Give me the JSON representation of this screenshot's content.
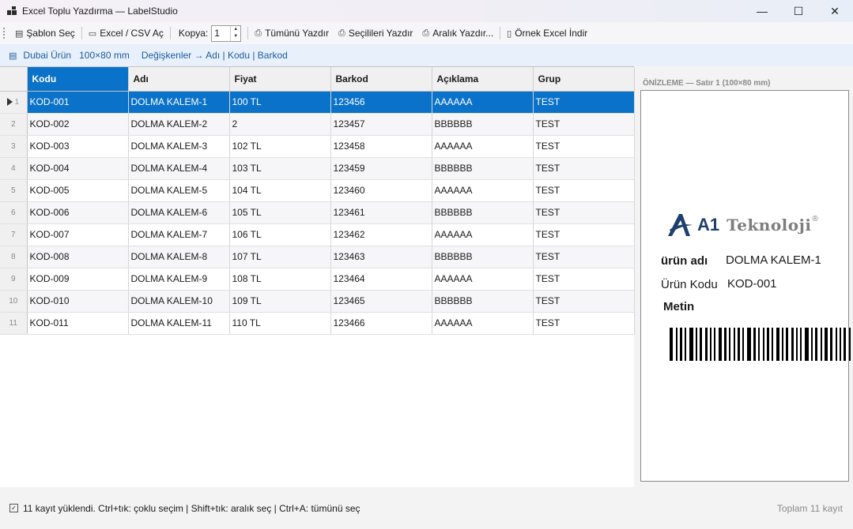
{
  "window": {
    "title": "Excel Toplu Yazdırma — LabelStudio",
    "minimize_icon": "—",
    "maximize_icon": "☐",
    "close_icon": "✕"
  },
  "toolbar": {
    "template_select": "Şablon Seç",
    "open_excel": "Excel / CSV Aç",
    "copies_label": "Kopya:",
    "copies_value": "1",
    "print_all": "Tümünü Yazdır",
    "print_selected": "Seçilileri Yazdır",
    "print_range": "Aralık Yazdır...",
    "download_sample": "Örnek Excel İndir"
  },
  "infobar": {
    "template_name": "Dubai Ürün",
    "template_size": "100×80 mm",
    "variables": "Değişkenler → Adı  |  Kodu  |  Barkod"
  },
  "grid": {
    "columns": [
      "Kodu",
      "Adı",
      "Fiyat",
      "Barkod",
      "Açıklama",
      "Grup"
    ],
    "selected_column": 0,
    "selected_row": 0,
    "rows": [
      {
        "n": "1",
        "cells": [
          "KOD-001",
          "DOLMA KALEM-1",
          "100 TL",
          "123456",
          "AAAAAA",
          "TEST"
        ]
      },
      {
        "n": "2",
        "cells": [
          "KOD-002",
          "DOLMA KALEM-2",
          "2",
          "123457",
          "BBBBBB",
          "TEST"
        ]
      },
      {
        "n": "3",
        "cells": [
          "KOD-003",
          "DOLMA KALEM-3",
          "102 TL",
          "123458",
          "AAAAAA",
          "TEST"
        ]
      },
      {
        "n": "4",
        "cells": [
          "KOD-004",
          "DOLMA KALEM-4",
          "103 TL",
          "123459",
          "BBBBBB",
          "TEST"
        ]
      },
      {
        "n": "5",
        "cells": [
          "KOD-005",
          "DOLMA KALEM-5",
          "104 TL",
          "123460",
          "AAAAAA",
          "TEST"
        ]
      },
      {
        "n": "6",
        "cells": [
          "KOD-006",
          "DOLMA KALEM-6",
          "105 TL",
          "123461",
          "BBBBBB",
          "TEST"
        ]
      },
      {
        "n": "7",
        "cells": [
          "KOD-007",
          "DOLMA KALEM-7",
          "106 TL",
          "123462",
          "AAAAAA",
          "TEST"
        ]
      },
      {
        "n": "8",
        "cells": [
          "KOD-008",
          "DOLMA KALEM-8",
          "107 TL",
          "123463",
          "BBBBBB",
          "TEST"
        ]
      },
      {
        "n": "9",
        "cells": [
          "KOD-009",
          "DOLMA KALEM-9",
          "108 TL",
          "123464",
          "AAAAAA",
          "TEST"
        ]
      },
      {
        "n": "10",
        "cells": [
          "KOD-010",
          "DOLMA KALEM-10",
          "109 TL",
          "123465",
          "BBBBBB",
          "TEST"
        ]
      },
      {
        "n": "11",
        "cells": [
          "KOD-011",
          "DOLMA KALEM-11",
          "110 TL",
          "123466",
          "AAAAAA",
          "TEST"
        ]
      }
    ]
  },
  "preview": {
    "header": "ÖNİZLEME — Satır 1  (100×80 mm)",
    "logo_a1": "A1",
    "logo_tek": "Teknoloji",
    "logo_reg": "®",
    "product_name_label": "ürün adı",
    "product_name_value": "DOLMA KALEM-1",
    "product_code_label": "Ürün Kodu",
    "product_code_value": "KOD-001",
    "free_text": "Metin"
  },
  "status": {
    "message": "11 kayıt yüklendi.  Ctrl+tık: çoklu seçim  |  Shift+tık: aralık seç  |  Ctrl+A: tümünü seç",
    "total": "Toplam 11 kayıt"
  },
  "colors": {
    "accent": "#0a72c8",
    "info_text": "#1e5aa0",
    "logo_blue": "#1f3f6e",
    "logo_gray": "#7d7d7d"
  }
}
